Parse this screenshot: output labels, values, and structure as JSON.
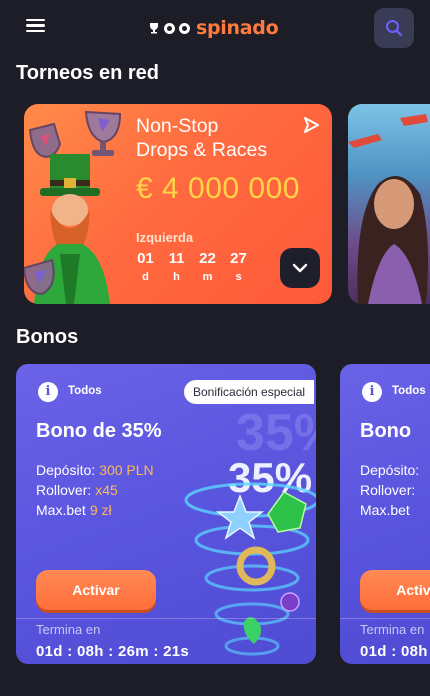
{
  "header": {
    "menu_icon": "hamburger-icon",
    "logo_text": "spinado",
    "search_icon": "search-icon"
  },
  "tournaments": {
    "section_title": "Torneos en red",
    "card": {
      "title_line1": "Non-Stop",
      "title_line2": "Drops & Races",
      "amount": "€ 4 000 000",
      "left_label": "Izquierda",
      "timer": [
        {
          "value": "01",
          "unit": "d"
        },
        {
          "value": "11",
          "unit": "h"
        },
        {
          "value": "22",
          "unit": "m"
        },
        {
          "value": "27",
          "unit": "s"
        }
      ]
    }
  },
  "bonuses": {
    "section_title": "Bonos",
    "cards": [
      {
        "category": "Todos",
        "badge": "Bonificación especial",
        "title": "Bono de 35%",
        "deposit_label": "Depósito:",
        "deposit_value": "300 PLN",
        "rollover_label": "Rollover:",
        "rollover_value": "x45",
        "maxbet_label": "Max.bet",
        "maxbet_value": "9 zł",
        "art_text": "35%",
        "activate_label": "Activar",
        "ends_label": "Termina en",
        "countdown": "01d : 08h : 26m : 21s"
      },
      {
        "category": "Todos",
        "title": "Bono",
        "deposit_label": "Depósito:",
        "rollover_label": "Rollover:",
        "maxbet_label": "Max.bet",
        "activate_label": "Activar",
        "ends_label": "Termina en",
        "countdown": "01d : 08h"
      }
    ]
  },
  "colors": {
    "background": "#1c1d26",
    "brand_orange": "#ff7a3d",
    "tournament_gradient": "#ff6a3f",
    "bonus_card": "#5a55de",
    "amount_yellow": "#ffd548",
    "value_orange": "#ffb85a"
  }
}
